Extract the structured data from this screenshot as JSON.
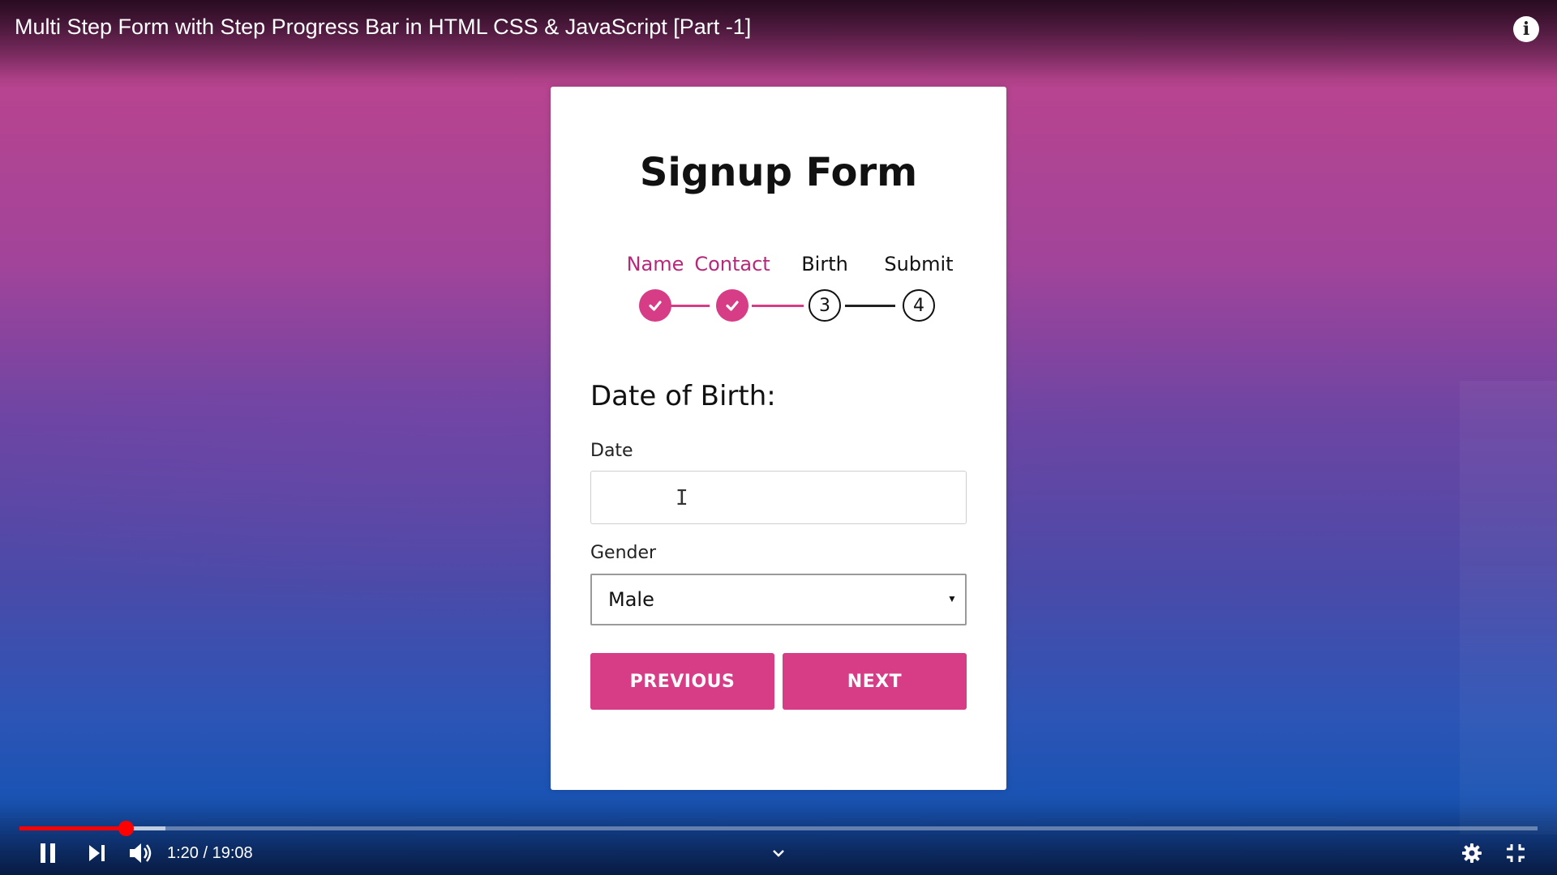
{
  "video": {
    "title": "Multi Step Form with Step Progress Bar in HTML CSS & JavaScript [Part -1]",
    "info_icon": "info-icon"
  },
  "form": {
    "title": "Signup Form",
    "steps": [
      {
        "label": "Name",
        "marker": "",
        "status": "done"
      },
      {
        "label": "Contact",
        "marker": "",
        "status": "done"
      },
      {
        "label": "Birth",
        "marker": "3",
        "status": "todo"
      },
      {
        "label": "Submit",
        "marker": "4",
        "status": "todo"
      }
    ],
    "section_title": "Date of Birth:",
    "date_label": "Date",
    "date_value": "",
    "gender_label": "Gender",
    "gender_value": "Male",
    "prev_label": "PREVIOUS",
    "next_label": "NEXT",
    "accent_color": "#d63d86"
  },
  "player": {
    "current_time": "1:20",
    "duration": "19:08",
    "time_text": "1:20 / 19:08",
    "played_fraction": 0.0698,
    "buffered_fraction": 0.0962,
    "icons": [
      "pause-icon",
      "next-icon",
      "volume-icon",
      "chevron-down-icon",
      "settings-icon",
      "exit-fullscreen-icon"
    ]
  }
}
